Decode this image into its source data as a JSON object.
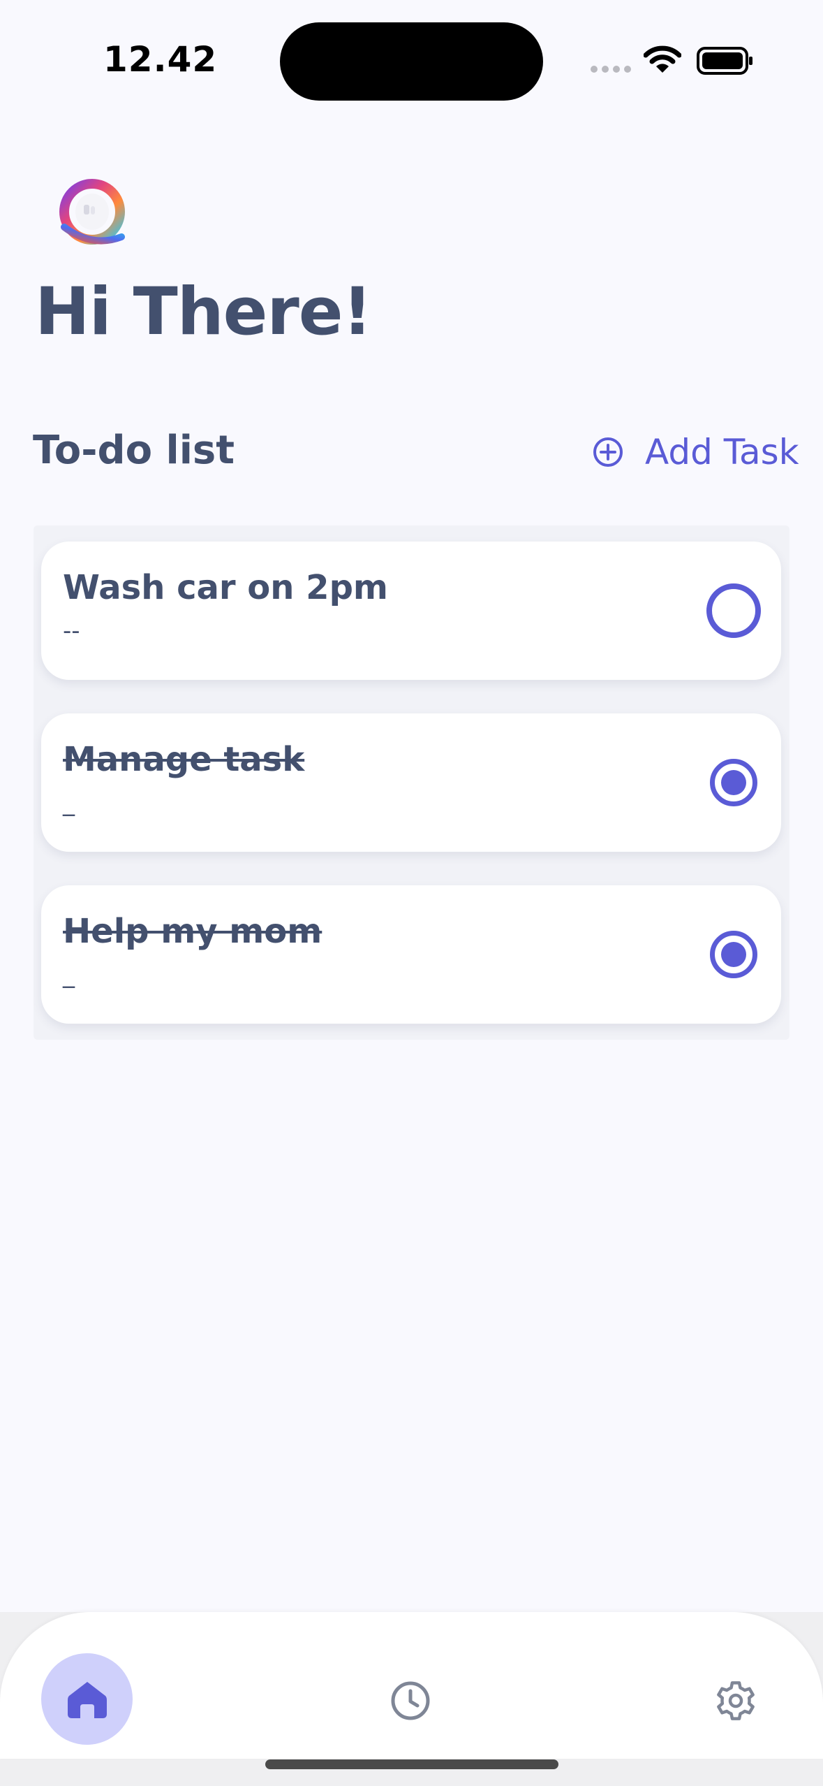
{
  "status_bar": {
    "time": "12.42"
  },
  "header": {
    "greeting": "Hi There!"
  },
  "todo": {
    "section_title": "To-do list",
    "add_task_label": "Add Task",
    "tasks": [
      {
        "title": "Wash car on 2pm",
        "subtitle": "--",
        "completed": false
      },
      {
        "title": "Manage task",
        "subtitle": "_",
        "completed": true
      },
      {
        "title": "Help my mom",
        "subtitle": "_",
        "completed": true
      }
    ]
  },
  "bottom_nav": {
    "items": [
      {
        "icon": "home-icon",
        "active": true
      },
      {
        "icon": "clock-icon",
        "active": false
      },
      {
        "icon": "gear-icon",
        "active": false
      }
    ]
  },
  "colors": {
    "accent": "#5a5bd6",
    "text": "#43506e",
    "background": "#f9f9fe",
    "nav_active_bg": "#cfd0fb"
  }
}
